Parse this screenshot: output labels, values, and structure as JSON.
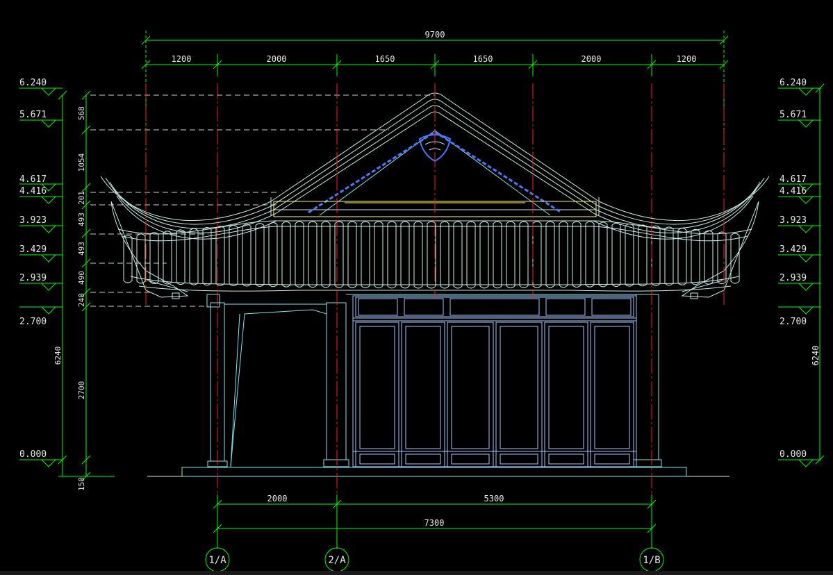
{
  "colors": {
    "background": "#000000",
    "dimension": "#00ff00",
    "axis": "#ff2020",
    "roof": "#c8f0e8",
    "structure": "#7fe6f0",
    "panel": "#9ec8ff",
    "ornament": "#4a78ff",
    "ridge_board": "#ffff60",
    "hidden": "#d8d8d8",
    "text": "#e8e8e8"
  },
  "overall_width": "9700",
  "top_dims": [
    "1200",
    "2000",
    "1650",
    "1650",
    "2000",
    "1200"
  ],
  "level_marks": [
    "6.240",
    "5.671",
    "4.617",
    "4.416",
    "3.923",
    "3.429",
    "2.939",
    "2.700",
    "0.000"
  ],
  "vertical_dims": [
    "568",
    "1054",
    "201",
    "493",
    "493",
    "490",
    "240",
    "2700",
    "6240",
    "150"
  ],
  "right_total": "6240",
  "bottom_dims": [
    "2000",
    "5300"
  ],
  "bottom_total": "7300",
  "axis_labels": [
    "1/A",
    "2/A",
    "1/B"
  ]
}
